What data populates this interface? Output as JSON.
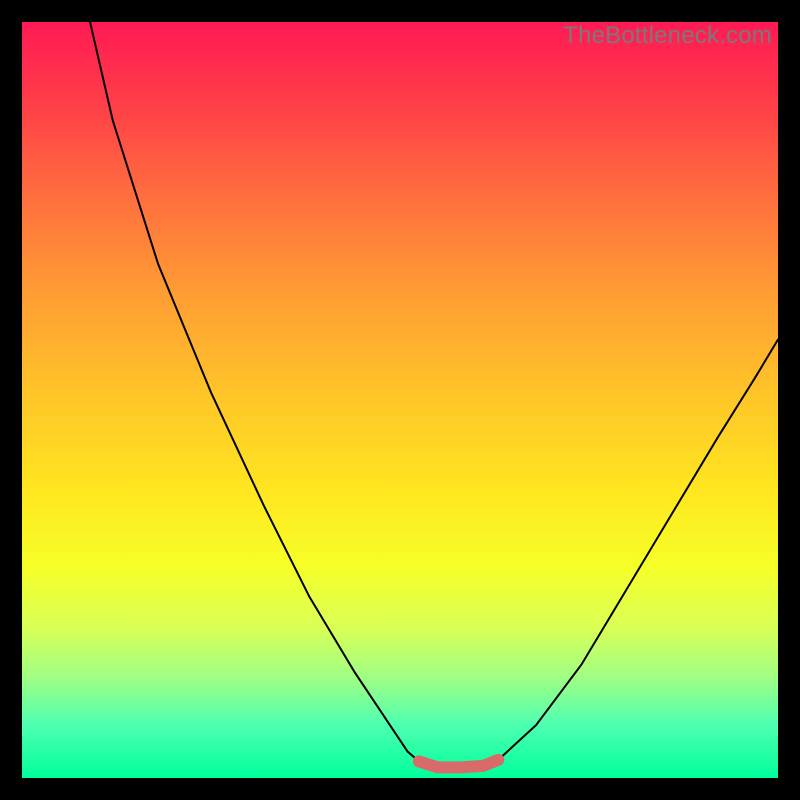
{
  "watermark": "TheBottleneck.com",
  "colors": {
    "frame": "#000000",
    "watermark_text": "#7a7a7a",
    "curve_stroke": "#000000",
    "bottom_band_stroke": "#d96a6a",
    "gradient_css": "linear-gradient(to bottom, #ff1a54 0%, #ff3b49 10%, #ff6a3f 22%, #ff9a34 35%, #ffc728 50%, #ffe61f 62%, #f6ff28 72%, #d9ff55 80%, #9cff86 87%, #4effb1 93%, #00ff9a 100%)"
  },
  "chart_data": {
    "type": "line",
    "title": "",
    "xlabel": "",
    "ylabel": "",
    "xlim": [
      0,
      100
    ],
    "ylim": [
      0,
      100
    ],
    "series": [
      {
        "name": "left-curve",
        "x": [
          9,
          12,
          18,
          25,
          32,
          38,
          44,
          48,
          51,
          52.5
        ],
        "values": [
          100,
          87,
          68,
          51,
          36,
          24,
          14,
          8,
          3.5,
          2.2
        ]
      },
      {
        "name": "bottom-band",
        "x": [
          52.5,
          55,
          58,
          61,
          63
        ],
        "values": [
          2.2,
          1.4,
          1.4,
          1.6,
          2.4
        ]
      },
      {
        "name": "right-curve",
        "x": [
          63,
          68,
          74,
          80,
          86,
          92,
          97,
          100
        ],
        "values": [
          2.4,
          7,
          15,
          25,
          35,
          45,
          53,
          58
        ]
      }
    ],
    "annotations": [
      {
        "text": "TheBottleneck.com",
        "position": "top-right"
      }
    ]
  }
}
